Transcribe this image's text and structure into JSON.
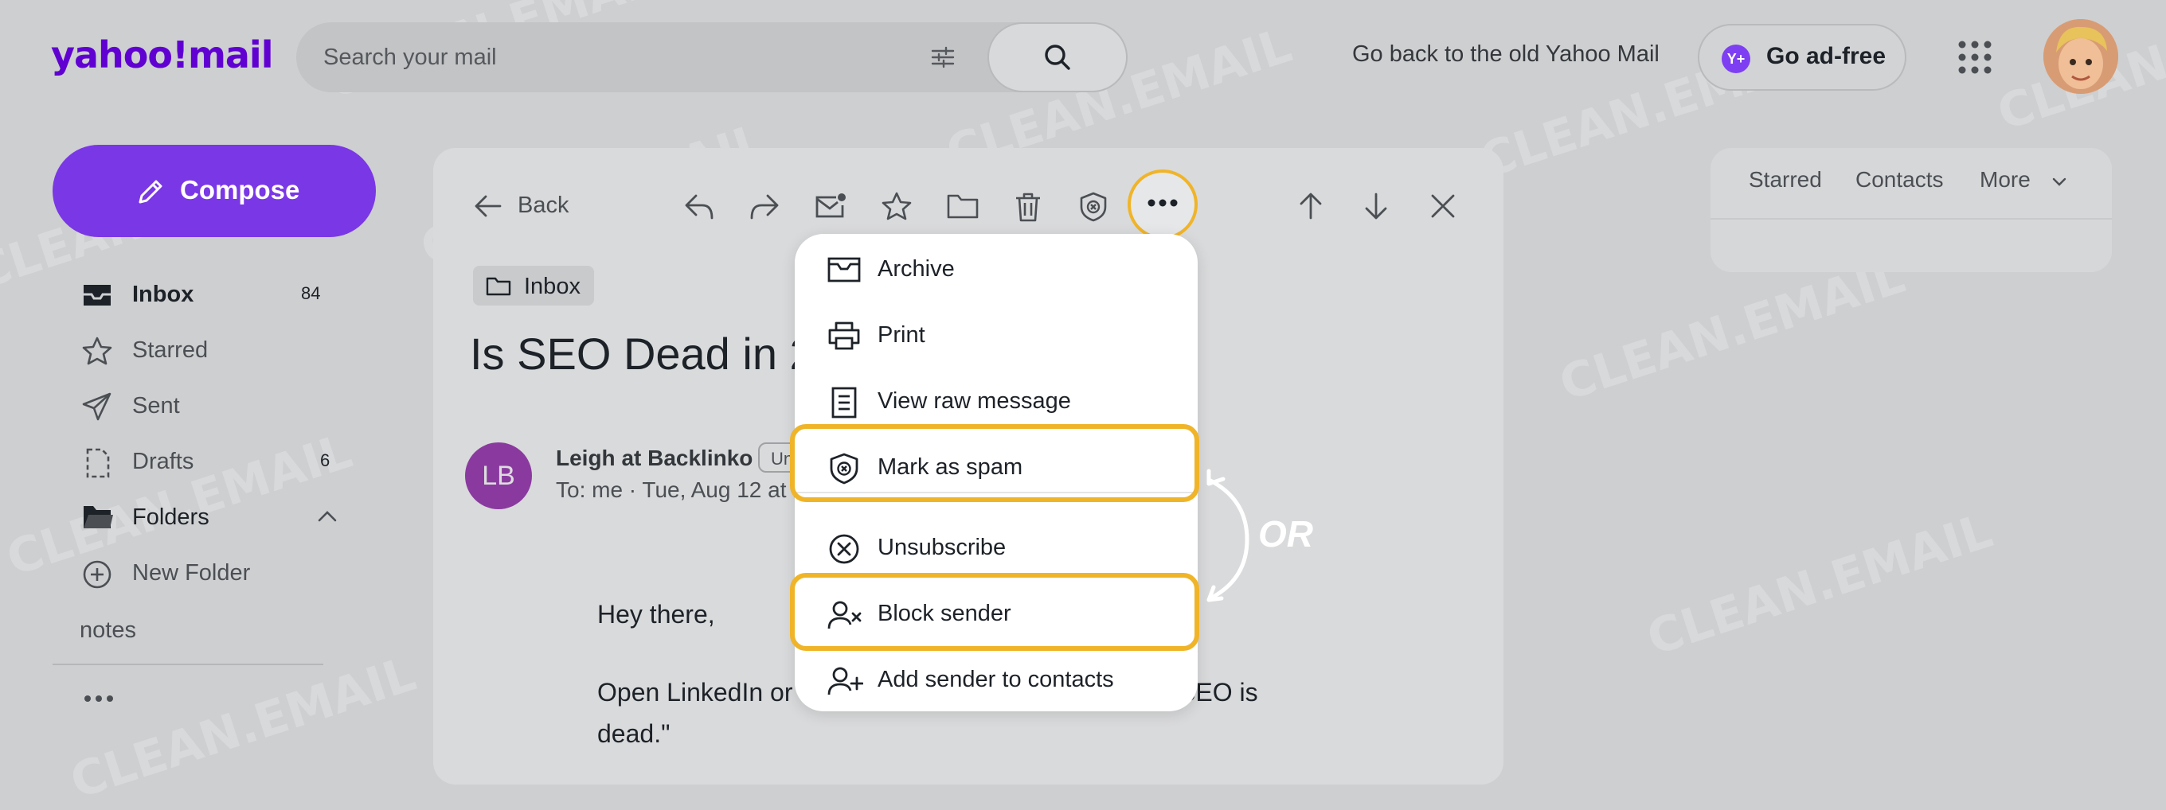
{
  "header": {
    "logo": "yahoo!mail",
    "search_placeholder": "Search your mail",
    "old_mail_link": "Go back to the old Yahoo Mail",
    "ad_free_label": "Go ad-free",
    "ad_free_icon_text": "Y+"
  },
  "compose_label": "Compose",
  "sidebar": {
    "inbox": {
      "label": "Inbox",
      "count": "84"
    },
    "starred": {
      "label": "Starred"
    },
    "sent": {
      "label": "Sent"
    },
    "drafts": {
      "label": "Drafts",
      "count": "6"
    },
    "folders": {
      "label": "Folders"
    },
    "new_folder": {
      "label": "New Folder"
    },
    "notes": "notes"
  },
  "toolbar": {
    "back_label": "Back"
  },
  "message": {
    "folder": "Inbox",
    "subject": "Is SEO Dead in 2",
    "sender_initials": "LB",
    "sender_name": "Leigh at Backlinko",
    "sender_tag": "Un",
    "recipient_line": "To:  me · Tue, Aug 12 at 1",
    "greeting": "Hey there,",
    "body_line1a": "Open LinkedIn or",
    "body_line1b": "SEO is",
    "body_line2": "dead.\""
  },
  "right_panel": {
    "tabs": [
      "Starred",
      "Contacts",
      "More"
    ]
  },
  "more_menu": {
    "items": [
      "Archive",
      "Print",
      "View raw message",
      "Mark as spam",
      "Unsubscribe",
      "Block sender",
      "Add sender to contacts"
    ]
  },
  "annotation": {
    "or_label": "OR",
    "highlight_color": "#f0b429"
  },
  "watermark": "CLEAN.EMAIL",
  "colors": {
    "brand": "#6001d2",
    "compose": "#7a37e6"
  }
}
